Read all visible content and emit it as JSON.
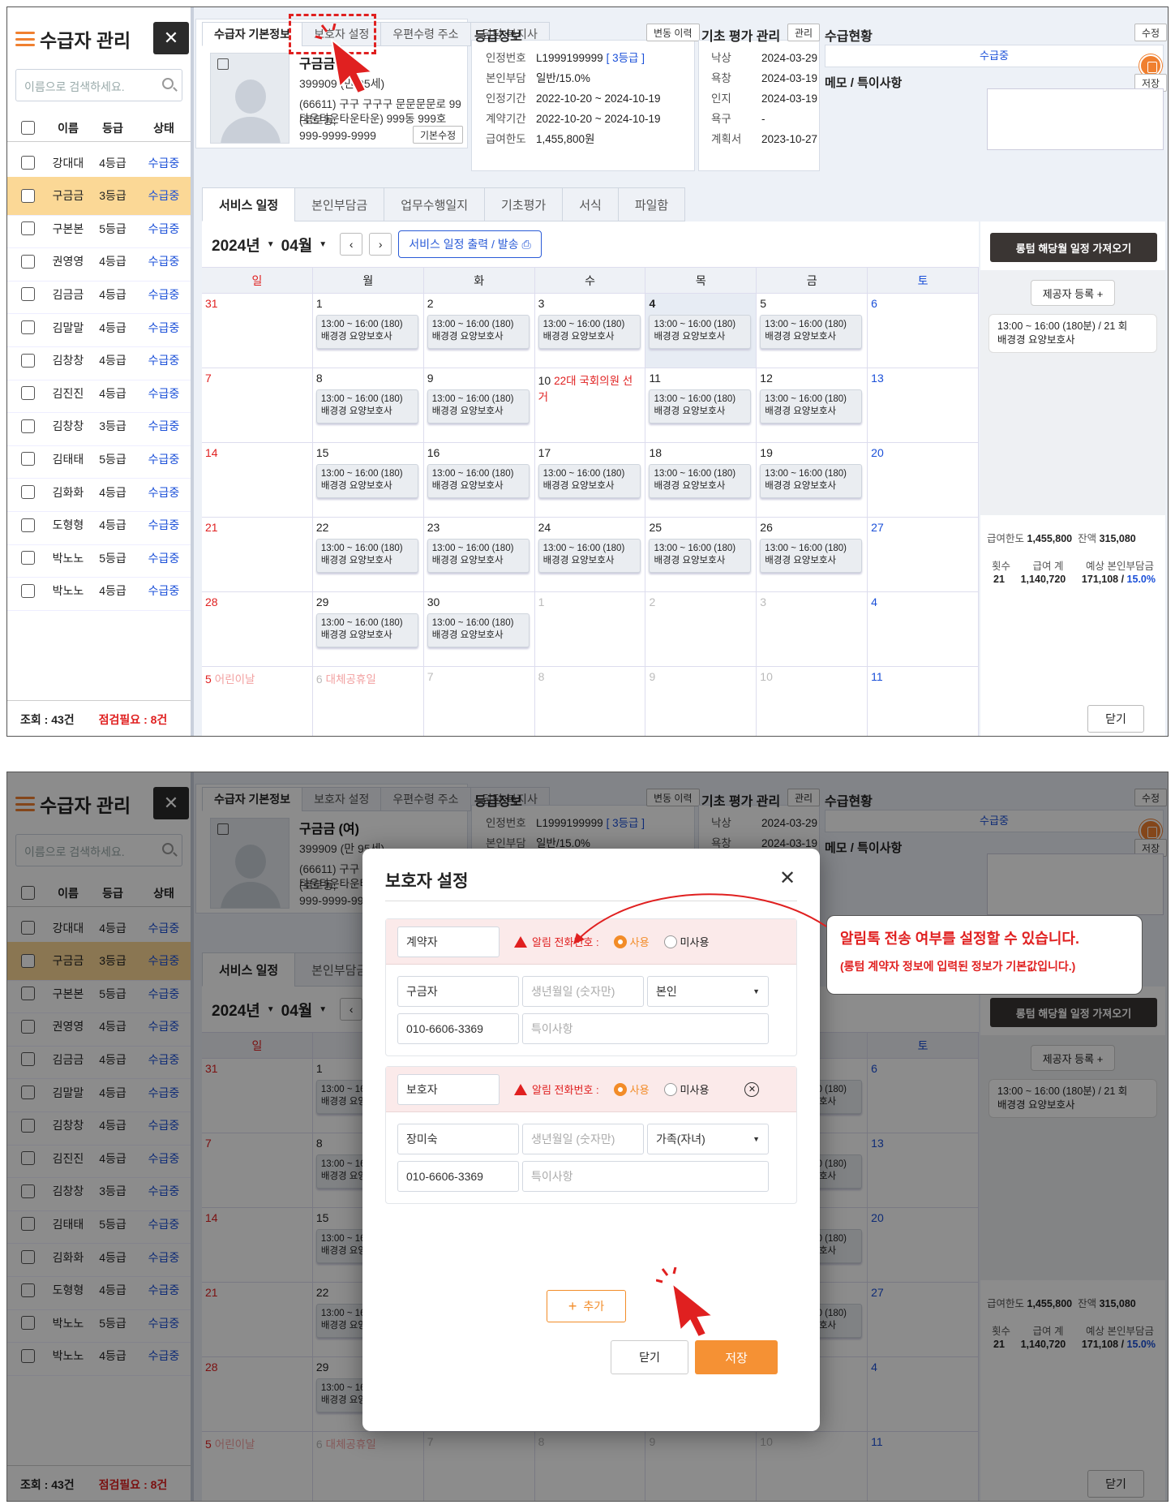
{
  "sidebar": {
    "title": "수급자 관리",
    "close": "✕",
    "search_placeholder": "이름으로 검색하세요.",
    "cols": {
      "name": "이름",
      "grade": "등급",
      "state": "상태"
    },
    "rows": [
      {
        "name": "강대대",
        "grade": "4등급",
        "state": "수급중"
      },
      {
        "name": "구금금",
        "grade": "3등급",
        "state": "수급중"
      },
      {
        "name": "구본본",
        "grade": "5등급",
        "state": "수급중"
      },
      {
        "name": "권영영",
        "grade": "4등급",
        "state": "수급중"
      },
      {
        "name": "김금금",
        "grade": "4등급",
        "state": "수급중"
      },
      {
        "name": "김말말",
        "grade": "4등급",
        "state": "수급중"
      },
      {
        "name": "김창창",
        "grade": "4등급",
        "state": "수급중"
      },
      {
        "name": "김진진",
        "grade": "4등급",
        "state": "수급중"
      },
      {
        "name": "김창창",
        "grade": "3등급",
        "state": "수급중"
      },
      {
        "name": "김태태",
        "grade": "5등급",
        "state": "수급중"
      },
      {
        "name": "김화화",
        "grade": "4등급",
        "state": "수급중"
      },
      {
        "name": "도형형",
        "grade": "4등급",
        "state": "수급중"
      },
      {
        "name": "박노노",
        "grade": "5등급",
        "state": "수급중"
      },
      {
        "name": "박노노",
        "grade": "4등급",
        "state": "수급중"
      }
    ],
    "count": "조회 : 43건",
    "check": "점검필요 : 8건"
  },
  "top_tabs": [
    "수급자 기본정보",
    "보호자 설정",
    "우편수령 주소",
    "담당 복지사"
  ],
  "profile": {
    "name": "구금금 (여)",
    "id": "399909 (만 95세)",
    "addr1": "(66611) 구구 구구구 문문문문로 99 (로로동,",
    "addr2": "타운타운타운타운) 999동 999호",
    "phone": "999-9999-9999",
    "edit_btn": "기본수정"
  },
  "grade_info": {
    "title": "등급정보",
    "history_btn": "변동 이력",
    "rows": [
      {
        "k": "인정번호",
        "v": "L1999199999",
        "extra": "[ 3등급 ]"
      },
      {
        "k": "본인부담",
        "v": "일반/15.0%"
      },
      {
        "k": "인정기간",
        "v": "2022-10-20 ~ 2024-10-19"
      },
      {
        "k": "계약기간",
        "v": "2022-10-20 ~ 2024-10-19"
      },
      {
        "k": "급여한도",
        "v": "1,455,800원"
      }
    ]
  },
  "assess": {
    "title": "기초 평가 관리",
    "btn": "관리",
    "rows": [
      {
        "k": "낙상",
        "v": "2024-03-29"
      },
      {
        "k": "욕창",
        "v": "2024-03-19"
      },
      {
        "k": "인지",
        "v": "2024-03-19"
      },
      {
        "k": "욕구",
        "v": "-"
      },
      {
        "k": "계획서",
        "v": "2023-10-27"
      }
    ]
  },
  "status": {
    "title": "수급현황",
    "edit": "수정",
    "value": "수급중",
    "memo_title": "메모 / 특이사항",
    "memo_save": "저장"
  },
  "mid_tabs": [
    "서비스 일정",
    "본인부담금",
    "업무수행일지",
    "기초평가",
    "서식",
    "파일함"
  ],
  "calendar": {
    "year": "2024년",
    "month": "04월",
    "print_btn": "서비스 일정 출력 / 발송",
    "weekdays": [
      "일",
      "월",
      "화",
      "수",
      "목",
      "금",
      "토"
    ],
    "event_l1": "13:00 ~ 16:00 (180)",
    "event_l2": "배경경 요양보호사",
    "weeks": [
      [
        {
          "d": "31",
          "dim": true
        },
        {
          "d": "1",
          "ev": true
        },
        {
          "d": "2",
          "ev": true
        },
        {
          "d": "3",
          "ev": true
        },
        {
          "d": "4",
          "ev": true,
          "hl": true
        },
        {
          "d": "5",
          "ev": true
        },
        {
          "d": "6"
        }
      ],
      [
        {
          "d": "7"
        },
        {
          "d": "8",
          "ev": true
        },
        {
          "d": "9",
          "ev": true
        },
        {
          "d": "10",
          "hol": "22대 국회의원 선거"
        },
        {
          "d": "11",
          "ev": true
        },
        {
          "d": "12",
          "ev": true
        },
        {
          "d": "13"
        }
      ],
      [
        {
          "d": "14"
        },
        {
          "d": "15",
          "ev": true
        },
        {
          "d": "16",
          "ev": true
        },
        {
          "d": "17",
          "ev": true
        },
        {
          "d": "18",
          "ev": true
        },
        {
          "d": "19",
          "ev": true
        },
        {
          "d": "20"
        }
      ],
      [
        {
          "d": "21"
        },
        {
          "d": "22",
          "ev": true
        },
        {
          "d": "23",
          "ev": true
        },
        {
          "d": "24",
          "ev": true
        },
        {
          "d": "25",
          "ev": true
        },
        {
          "d": "26",
          "ev": true
        },
        {
          "d": "27"
        }
      ],
      [
        {
          "d": "28"
        },
        {
          "d": "29",
          "ev": true
        },
        {
          "d": "30",
          "ev": true
        },
        {
          "d": "1",
          "dim": true
        },
        {
          "d": "2",
          "dim": true
        },
        {
          "d": "3",
          "dim": true
        },
        {
          "d": "4",
          "dim": true
        }
      ],
      [
        {
          "d": "5",
          "dim": true,
          "hol": "어린이날"
        },
        {
          "d": "6",
          "dim": true,
          "hol": "대체공휴일"
        },
        {
          "d": "7",
          "dim": true
        },
        {
          "d": "8",
          "dim": true
        },
        {
          "d": "9",
          "dim": true
        },
        {
          "d": "10",
          "dim": true
        },
        {
          "d": "11",
          "dim": true
        }
      ]
    ]
  },
  "right": {
    "import_btn": "롱텀 해당월 일정 가져오기",
    "provider_btn": "제공자 등록 +",
    "card_l1": "13:00 ~ 16:00 (180분) / 21 회",
    "card_l2": "배경경 요양보호사",
    "limit_k": "급여한도",
    "limit_v": "1,455,800",
    "bal_k": "잔액",
    "bal_v": "315,080",
    "h1": "횟수",
    "h2": "급여 계",
    "h3": "예상 본인부담금",
    "v1": "21",
    "v2": "1,140,720",
    "v3": "171,108 /",
    "v3b": "15.0%",
    "close": "닫기"
  },
  "modal": {
    "title": "보호자 설정",
    "close_x": "✕",
    "alert_label": "알림 전화번호 :",
    "use": "사용",
    "nouse": "미사용",
    "g1": {
      "role": "계약자",
      "name": "구금자",
      "birth_ph": "생년월일 (숫자만)",
      "rel": "본인",
      "phone": "010-6606-3369",
      "note_ph": "특이사항"
    },
    "g2": {
      "role": "보호자",
      "name": "장미숙",
      "birth_ph": "생년월일 (숫자만)",
      "rel": "가족(자녀)",
      "phone": "010-6606-3369",
      "note_ph": "특이사항"
    },
    "add": "추가",
    "cancel": "닫기",
    "save": "저장"
  },
  "callout": {
    "line1": "알림톡 전송 여부를 설정할 수 있습니다.",
    "line2": "(롱텀 계약자 정보에 입력된 정보가 기본값입니다.)"
  },
  "colors": {
    "accent": "#f28c28",
    "blue": "#1a4fd8",
    "red": "#e02020"
  }
}
